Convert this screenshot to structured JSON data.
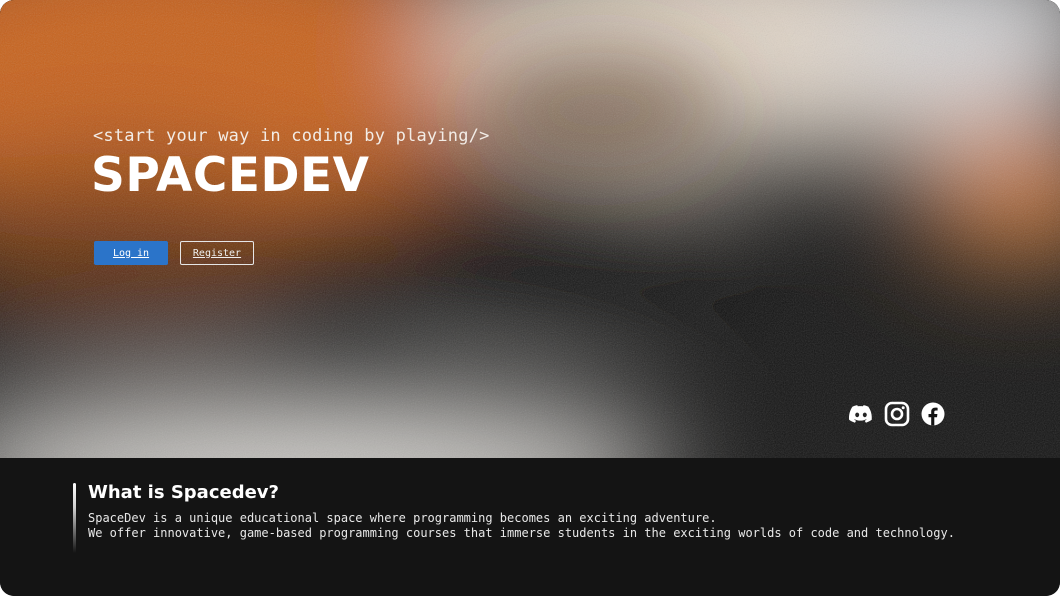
{
  "hero": {
    "tagline": "<start your way in coding by playing/>",
    "brand": "SPACEDEV",
    "login_label": "Log in",
    "register_label": "Register",
    "socials": [
      "discord-icon",
      "instagram-icon",
      "facebook-icon"
    ]
  },
  "about": {
    "title": "What is Spacedev?",
    "line1": "SpaceDev is a unique educational space where programming becomes an exciting adventure.",
    "line2": "We offer innovative, game-based programming courses that immerse students in the exciting worlds of code and technology."
  },
  "colors": {
    "accent": "#2b74c9",
    "orange": "#c45a15",
    "dark": "#141414",
    "cream": "#e2d6c8"
  }
}
